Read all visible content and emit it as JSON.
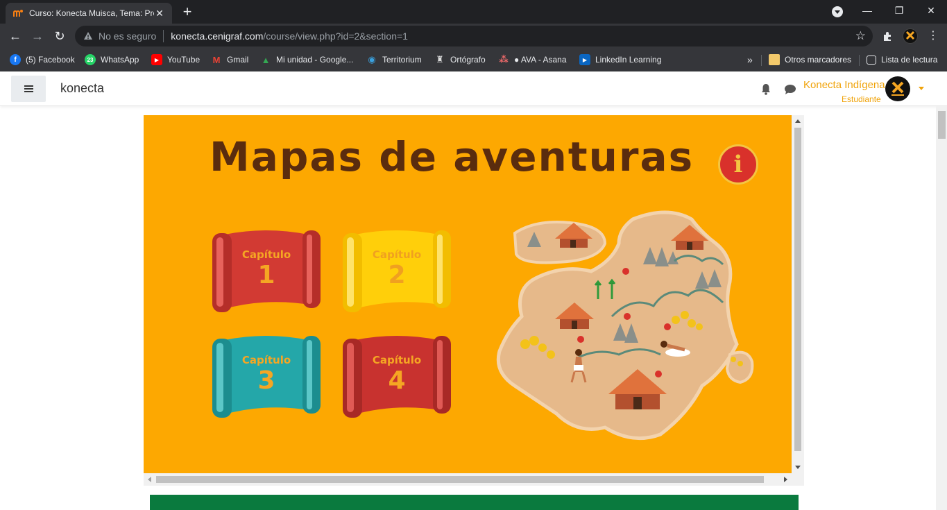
{
  "browser": {
    "tab_title": "Curso: Konecta Muisca, Tema: Pre",
    "tab_close": "✕",
    "new_tab": "+",
    "window_controls": {
      "minimize": "—",
      "restore": "❐",
      "close": "✕"
    },
    "security_label": "No es seguro",
    "url_host": "konecta.cenigraf.com",
    "url_path": "/course/view.php?id=2&section=1",
    "star_icon": "☆",
    "menu_icon": "⋮"
  },
  "bookmarks": [
    {
      "label": "(5) Facebook",
      "icon": "facebook-icon",
      "color": "#1877f2",
      "glyph": "f"
    },
    {
      "label": "WhatsApp",
      "icon": "whatsapp-icon",
      "color": "#25d366",
      "glyph": "23"
    },
    {
      "label": "YouTube",
      "icon": "youtube-icon",
      "color": "#ff0000",
      "glyph": "▶"
    },
    {
      "label": "Gmail",
      "icon": "gmail-icon",
      "color": "#ea4335",
      "glyph": "M"
    },
    {
      "label": "Mi unidad - Google...",
      "icon": "google-drive-icon",
      "color": "#34a853",
      "glyph": "▲"
    },
    {
      "label": "Territorium",
      "icon": "territorium-icon",
      "color": "#3aa0dd",
      "glyph": "◉"
    },
    {
      "label": "Ortógrafo",
      "icon": "ortografo-icon",
      "color": "#444",
      "glyph": "♜"
    },
    {
      "label": "● AVA - Asana",
      "icon": "asana-icon",
      "color": "#f06a6a",
      "glyph": "⁂"
    },
    {
      "label": "LinkedIn Learning",
      "icon": "linkedin-learning-icon",
      "color": "#0a66c2",
      "glyph": "▶"
    }
  ],
  "bookmarks_overflow": "»",
  "other_bookmarks": "Otros marcadores",
  "reading_list": "Lista de lectura",
  "moodle": {
    "site_name": "konecta",
    "user_name": "Konecta Indígena",
    "user_role": "Estudiante"
  },
  "stage": {
    "title": "Mapas de aventuras",
    "info_glyph": "i",
    "chapters": [
      {
        "label": "Capítulo",
        "number": "1",
        "color": "#d23a33",
        "text_color": "#f5a623"
      },
      {
        "label": "Capítulo",
        "number": "2",
        "color": "#ffcf0a",
        "text_color": "#f0a020"
      },
      {
        "label": "Capítulo",
        "number": "3",
        "color": "#24a7a9",
        "text_color": "#f5a623"
      },
      {
        "label": "Capítulo",
        "number": "4",
        "color": "#c8322f",
        "text_color": "#f5a623"
      }
    ]
  },
  "colors": {
    "stage_bg": "#fda801",
    "accent": "#f0a30a",
    "title_brown": "#5a2c0e",
    "green_bar": "#0a7a3e"
  }
}
